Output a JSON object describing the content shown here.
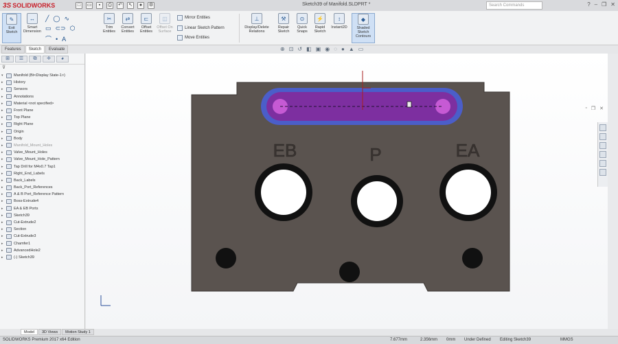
{
  "app": {
    "brand": "SOLIDWORKS",
    "brand_mark": "3S"
  },
  "window": {
    "title": "Sketch39 of Manifold.SLDPRT *"
  },
  "search": {
    "placeholder": "Search Commands"
  },
  "commands": {
    "sketch_exit": "Exit Sketch",
    "smart_dimension": "Smart Dimension",
    "trim": "Trim Entities",
    "convert": "Convert Entities",
    "offset": "Offset Entities",
    "offset_surface": "Offset On Surface",
    "mirror": "Mirror Entities",
    "linear_pattern": "Linear Sketch Pattern",
    "move": "Move Entities",
    "display_delete": "Display/Delete Relations",
    "repair": "Repair Sketch",
    "quick_snaps": "Quick Snaps",
    "rapid": "Rapid Sketch",
    "instant2d": "Instant2D",
    "shaded": "Shaded Sketch Contours"
  },
  "tabs": [
    "Features",
    "Sketch",
    "Evaluate"
  ],
  "tree": {
    "root": "Manifold (Bt<Display State-1>)",
    "items": [
      {
        "label": "History",
        "grey": false
      },
      {
        "label": "Sensors",
        "grey": false
      },
      {
        "label": "Annotations",
        "grey": false
      },
      {
        "label": "Material <not specified>",
        "grey": false
      },
      {
        "label": "Front Plane",
        "grey": false
      },
      {
        "label": "Top Plane",
        "grey": false
      },
      {
        "label": "Right Plane",
        "grey": false
      },
      {
        "label": "Origin",
        "grey": false
      },
      {
        "label": "Body",
        "grey": false
      },
      {
        "label": "Manifold_Mount_Holes",
        "grey": true
      },
      {
        "label": "Valve_Mount_Holes",
        "grey": false
      },
      {
        "label": "Valve_Mount_Hole_Pattern",
        "grey": false
      },
      {
        "label": "Tap Drill for M4x0.7 Tap1",
        "grey": false
      },
      {
        "label": "Right_End_Labels",
        "grey": false
      },
      {
        "label": "Back_Labels",
        "grey": false
      },
      {
        "label": "Back_Port_References",
        "grey": false
      },
      {
        "label": "A & B Port_Reference Pattern",
        "grey": false
      },
      {
        "label": "Boss-Extrude4",
        "grey": false
      },
      {
        "label": "EA & EB Ports",
        "grey": false
      },
      {
        "label": "Sketch39",
        "grey": false
      },
      {
        "label": "Cut-Extrude2",
        "grey": false
      },
      {
        "label": "Section",
        "grey": false
      },
      {
        "label": "Cut-Extrude3",
        "grey": false
      },
      {
        "label": "Chamfer1",
        "grey": false
      },
      {
        "label": "AdvancedHole2",
        "grey": false
      },
      {
        "label": "(-) Sketch39",
        "grey": false
      }
    ]
  },
  "model": {
    "port_labels": [
      "EB",
      "P",
      "EA"
    ],
    "colors": {
      "body": "#5a534f",
      "slot_outer": "#4b5ec9",
      "slot_inner": "#7d2fa0",
      "hole_center": "#c65ad4"
    }
  },
  "bottom_tabs": [
    "Model",
    "3D Views",
    "Motion Study 1"
  ],
  "status": {
    "edition": "SOLIDWORKS Premium 2017 x64 Edition",
    "x": "7.677mm",
    "y": "2.356mm",
    "z": "0mm",
    "state": "Under Defined",
    "editing": "Editing Sketch39",
    "units": "MMGS"
  }
}
